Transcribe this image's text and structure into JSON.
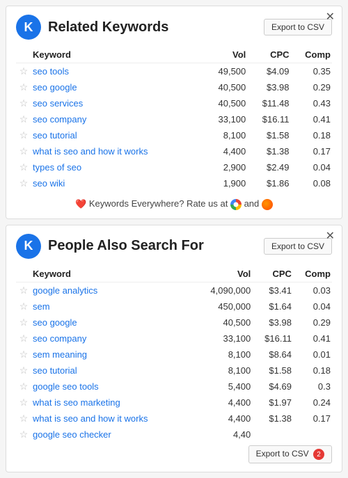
{
  "related_keywords": {
    "title": "Related Keywords",
    "logo_letter": "K",
    "export_label": "Export to CSV",
    "columns": [
      "Keyword",
      "Vol",
      "CPC",
      "Comp"
    ],
    "rows": [
      {
        "keyword": "seo tools",
        "vol": "49,500",
        "cpc": "$4.09",
        "comp": "0.35"
      },
      {
        "keyword": "seo google",
        "vol": "40,500",
        "cpc": "$3.98",
        "comp": "0.29"
      },
      {
        "keyword": "seo services",
        "vol": "40,500",
        "cpc": "$11.48",
        "comp": "0.43"
      },
      {
        "keyword": "seo company",
        "vol": "33,100",
        "cpc": "$16.11",
        "comp": "0.41"
      },
      {
        "keyword": "seo tutorial",
        "vol": "8,100",
        "cpc": "$1.58",
        "comp": "0.18"
      },
      {
        "keyword": "what is seo and how it works",
        "vol": "4,400",
        "cpc": "$1.38",
        "comp": "0.17"
      },
      {
        "keyword": "types of seo",
        "vol": "2,900",
        "cpc": "$2.49",
        "comp": "0.04"
      },
      {
        "keyword": "seo wiki",
        "vol": "1,900",
        "cpc": "$1.86",
        "comp": "0.08"
      }
    ],
    "rate_text_before": "Keywords Everywhere? Rate us at",
    "rate_text_between": "and"
  },
  "people_also_search": {
    "title": "People Also Search For",
    "logo_letter": "K",
    "export_label": "Export to CSV",
    "export_badge": "2",
    "columns": [
      "Keyword",
      "Vol",
      "CPC",
      "Comp"
    ],
    "rows": [
      {
        "keyword": "google analytics",
        "vol": "4,090,000",
        "cpc": "$3.41",
        "comp": "0.03"
      },
      {
        "keyword": "sem",
        "vol": "450,000",
        "cpc": "$1.64",
        "comp": "0.04"
      },
      {
        "keyword": "seo google",
        "vol": "40,500",
        "cpc": "$3.98",
        "comp": "0.29"
      },
      {
        "keyword": "seo company",
        "vol": "33,100",
        "cpc": "$16.11",
        "comp": "0.41"
      },
      {
        "keyword": "sem meaning",
        "vol": "8,100",
        "cpc": "$8.64",
        "comp": "0.01"
      },
      {
        "keyword": "seo tutorial",
        "vol": "8,100",
        "cpc": "$1.58",
        "comp": "0.18"
      },
      {
        "keyword": "google seo tools",
        "vol": "5,400",
        "cpc": "$4.69",
        "comp": "0.3"
      },
      {
        "keyword": "what is seo marketing",
        "vol": "4,400",
        "cpc": "$1.97",
        "comp": "0.24"
      },
      {
        "keyword": "what is seo and how it works",
        "vol": "4,400",
        "cpc": "$1.38",
        "comp": "0.17"
      },
      {
        "keyword": "google seo checker",
        "vol": "4,40",
        "cpc": "...",
        "comp": "..."
      }
    ]
  },
  "icons": {
    "close": "✕",
    "star": "☆",
    "heart": "❤"
  }
}
